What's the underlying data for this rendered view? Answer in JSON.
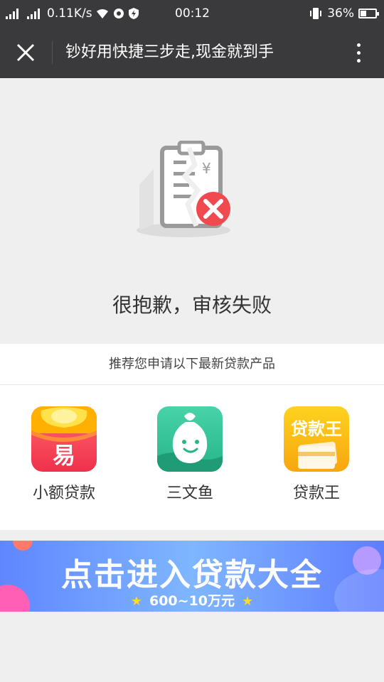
{
  "status_bar": {
    "speed": "0.11K/s",
    "time": "00:12",
    "battery": "36%"
  },
  "header": {
    "title": "钞好用快捷三步走,现金就到手"
  },
  "result": {
    "message": "很抱歉，审核失败"
  },
  "recommend": {
    "heading": "推荐您申请以下最新贷款产品",
    "products": [
      {
        "name": "小额贷款",
        "icon_text": "易",
        "icon": "gold-ingot-icon",
        "color": "#f0304c"
      },
      {
        "name": "三文鱼",
        "icon": "smiling-bag-icon",
        "color": "#26b489"
      },
      {
        "name": "贷款王",
        "icon_text": "贷款王",
        "icon": "card-icon",
        "color": "#f7a60f"
      }
    ]
  },
  "banner": {
    "title": "点击进入贷款大全",
    "subtitle": "600~10万元"
  },
  "colors": {
    "header_bg": "#3a3a3c",
    "error_red": "#f04a50"
  }
}
